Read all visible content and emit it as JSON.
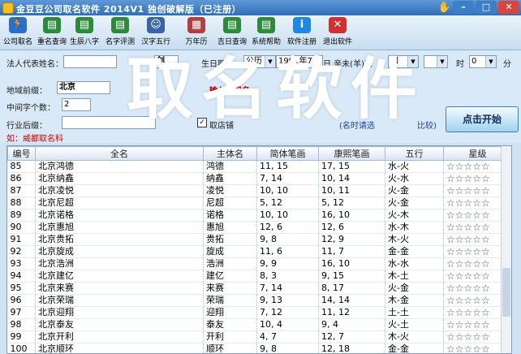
{
  "window": {
    "title": "金豆豆公司取名软件  2014V1  独创破解版（已注册）",
    "minimize": "–",
    "maximize": "□",
    "close": "✕"
  },
  "toolbar": [
    {
      "label": "公司取名",
      "icon": "runner-icon",
      "color": "#2a6fc9"
    },
    {
      "label": "重名查询",
      "icon": "book-icon",
      "color": "#2c8a3a"
    },
    {
      "label": "生辰八字",
      "icon": "book-icon",
      "color": "#2c8a3a"
    },
    {
      "label": "名字评测",
      "icon": "book-icon",
      "color": "#2c8a3a"
    },
    {
      "label": "汉字五行",
      "icon": "person-icon",
      "color": "#3a63a8"
    },
    {
      "label": "万年历",
      "icon": "calendar-icon",
      "color": "#b04040"
    },
    {
      "label": "吉日查询",
      "icon": "book-icon",
      "color": "#2c8a3a"
    },
    {
      "label": "系统帮助",
      "icon": "book-icon",
      "color": "#2c8a3a"
    },
    {
      "label": "软件注册",
      "icon": "info-icon",
      "color": "#1e88e5"
    },
    {
      "label": "退出软件",
      "icon": "exit-x-icon",
      "color": "#d32f2f"
    }
  ],
  "form": {
    "legal_label": "法人代表姓名：",
    "legal_value": "",
    "char_value": "剑",
    "birth_label": "生日期：",
    "calendar_select": "公历",
    "birth_value": "1991年7",
    "ganzhi_label": "日 辛未(羊)五",
    "ganzhi_select": "四",
    "hour_label": "时",
    "hour_select": "0",
    "minute_label": "分",
    "region_label": "地域前缀：",
    "region_value": "北京",
    "red_hint": "输入公司名",
    "mid_label": "中间字个数：",
    "mid_value": "2",
    "industry_label": "行业后缀：",
    "checkbox_label": "取店铺",
    "blue_hint": "(名时请选",
    "blue_hint2": "比较)",
    "red_footer": "如：威都取名科",
    "start_label": "点击开始"
  },
  "watermark": "取名软件",
  "table": {
    "columns": [
      "编号",
      "全名",
      "主体名",
      "简体笔画",
      "康熙笔画",
      "五行",
      "星级"
    ],
    "rows": [
      [
        "85",
        "北京鸿德",
        "鸿德",
        "11, 15",
        "17, 15",
        "水-火",
        "☆☆☆☆☆"
      ],
      [
        "86",
        "北京纳鑫",
        "纳鑫",
        "7, 14",
        "10, 14",
        "火-水",
        "☆☆☆☆☆"
      ],
      [
        "87",
        "北京凌悦",
        "凌悦",
        "10, 10",
        "10, 11",
        "火-金",
        "☆☆☆☆☆"
      ],
      [
        "88",
        "北京尼超",
        "尼超",
        "5, 12",
        "5, 12",
        "火-金",
        "☆☆☆☆☆"
      ],
      [
        "89",
        "北京诺格",
        "诺格",
        "10, 10",
        "16, 10",
        "火-木",
        "☆☆☆☆☆"
      ],
      [
        "90",
        "北京惠旭",
        "惠旭",
        "12, 6",
        "12, 6",
        "水-木",
        "☆☆☆☆☆"
      ],
      [
        "91",
        "北京贵拓",
        "贵拓",
        "9, 8",
        "12, 9",
        "木-火",
        "☆☆☆☆☆"
      ],
      [
        "92",
        "北京旋成",
        "旋成",
        "11, 6",
        "11, 7",
        "金-金",
        "☆☆☆☆☆"
      ],
      [
        "93",
        "北京浩洲",
        "浩洲",
        "9, 9",
        "16, 10",
        "水-水",
        "☆☆☆☆☆"
      ],
      [
        "94",
        "北京建亿",
        "建亿",
        "8, 3",
        "9, 15",
        "木-土",
        "☆☆☆☆☆"
      ],
      [
        "95",
        "北京来赛",
        "来赛",
        "7, 14",
        "8, 17",
        "火-金",
        "☆☆☆☆☆"
      ],
      [
        "96",
        "北京荣瑞",
        "荣瑞",
        "9, 13",
        "14, 14",
        "木-金",
        "☆☆☆☆☆"
      ],
      [
        "97",
        "北京迎翔",
        "迎翔",
        "7, 12",
        "11, 12",
        "土-土",
        "☆☆☆☆☆"
      ],
      [
        "98",
        "北京泰友",
        "泰友",
        "10, 4",
        "9, 4",
        "火-土",
        "☆☆☆☆☆"
      ],
      [
        "99",
        "北京开利",
        "开利",
        "4, 7",
        "12, 7",
        "木-火",
        "☆☆☆☆☆"
      ],
      [
        "100",
        "北京顺环",
        "顺环",
        "9, 8",
        "12, 18",
        "金-金",
        "☆☆☆☆☆"
      ]
    ]
  }
}
